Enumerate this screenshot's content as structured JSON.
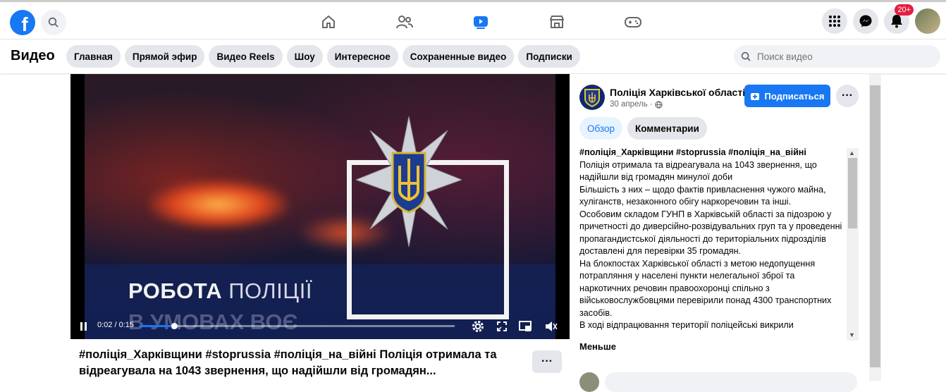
{
  "topbar": {
    "logo_letter": "f",
    "nav": [
      "home-icon",
      "friends-icon",
      "video-icon",
      "marketplace-icon",
      "gaming-icon"
    ],
    "notification_count": "20+"
  },
  "subbar": {
    "title": "Видео",
    "chips": [
      "Главная",
      "Прямой эфир",
      "Видео Reels",
      "Шоу",
      "Интересное",
      "Сохраненные видео",
      "Подписки"
    ],
    "search_placeholder": "Поиск видео"
  },
  "video": {
    "overlay_line1_bold": "РОБОТА ",
    "overlay_line1_thin": "ПОЛІЦІЇ",
    "overlay_line2": "В УМОВАХ ВОЄ",
    "current_time": "0:02 / 0:15",
    "progress": 0.11
  },
  "post": {
    "title": "#поліція_Харківщини #stoprussia #поліція_на_війні Поліція отримала та відреагувала на 1043 звернення, що надійшли від громадян..."
  },
  "side": {
    "page_name": "Поліція Харківської області",
    "date": "30 апрель ·",
    "subscribe_label": "Подписаться",
    "tab_overview": "Обзор",
    "tab_comments": "Комментарии",
    "description": {
      "hashtags": "#поліція_Харківщини #stoprussia #поліція_на_війні",
      "p1": "Поліція отримала та відреагувала на 1043 звернення, що надійшли від громадян минулої доби",
      "p2": "Більшість з них – щодо фактів привласнення чужого майна, хуліганств, незаконного обігу наркоречовин та інші.",
      "p3": "Особовим складом ГУНП в Харківській області за підозрою у причетності до диверсійно-розвідувальних груп та у проведенні пропагандистської діяльності до територіальних підрозділів доставлені для перевірки 35 громадян.",
      "p4": "На блокпостах Харківської області з метою недопущення потрапляння у населені пункти нелегальної зброї та наркотичних речовин правоохоронці спільно з військовослужбовцями перевірили понад 4300 транспортних засобів.",
      "p5": "В ході відпрацювання території поліцейські викрили"
    },
    "less_label": "Меньше"
  },
  "colors": {
    "accent": "#1877f2",
    "chip_bg": "#e4e6eb",
    "badge": "#e41e3f"
  }
}
